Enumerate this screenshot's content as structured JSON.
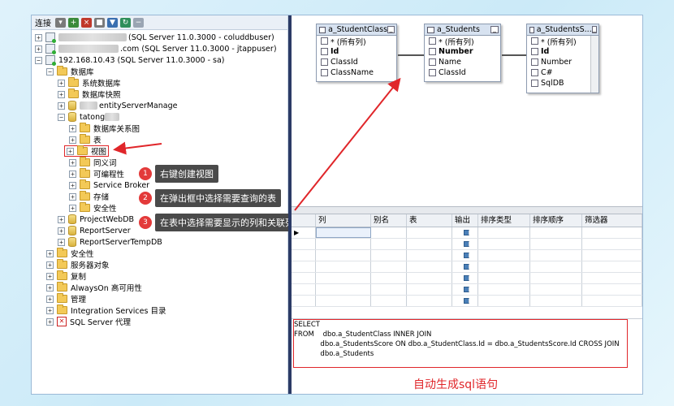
{
  "toolbar": {
    "connect_label": "连接"
  },
  "tree": {
    "server1": {
      "text_suffix": "(SQL Server 11.0.3000 - coluddbuser)"
    },
    "server2": {
      "text_suffix": ".com (SQL Server 11.0.3000 - jtappuser)"
    },
    "server3": {
      "label": "192.168.10.43 (SQL Server 11.0.3000 - sa)"
    },
    "databases": "数据库",
    "system_db": "系统数据库",
    "snapshots": "数据库快照",
    "db_identity_suffix": "entityServerManage",
    "db_current_prefix": "tatong",
    "db_diagram": "数据库关系图",
    "tables": "表",
    "views": "视图",
    "synonyms": "同义词",
    "programmability": "可编程性",
    "service_broker": "Service Broker",
    "storage": "存储",
    "security_inner": "安全性",
    "db_projectweb": "ProjectWebDB",
    "db_reportserver": "ReportServer",
    "db_reporttemp": "ReportServerTempDB",
    "security": "安全性",
    "server_objects": "服务器对象",
    "replication": "复制",
    "alwayson": "AlwaysOn 高可用性",
    "management": "管理",
    "integration": "Integration Services 目录",
    "agent": "SQL Server 代理"
  },
  "callouts": [
    {
      "num": "1",
      "text": "右键创建视图"
    },
    {
      "num": "2",
      "text": "在弹出框中选择需要查询的表"
    },
    {
      "num": "3",
      "text": "在表中选择需要显示的列和关联列"
    }
  ],
  "tables": [
    {
      "title": "a_StudentClass",
      "rows": [
        "* (所有列)",
        "Id",
        "ClassId",
        "ClassName"
      ],
      "bold": [
        "Id"
      ]
    },
    {
      "title": "a_Students",
      "rows": [
        "* (所有列)",
        "Number",
        "Name",
        "ClassId"
      ],
      "bold": [
        "Number"
      ]
    },
    {
      "title": "a_StudentsS...",
      "rows": [
        "* (所有列)",
        "Id",
        "Number",
        "C#",
        "SqlDB"
      ],
      "bold": [
        "Id"
      ]
    }
  ],
  "grid": {
    "headers": [
      "列",
      "别名",
      "表",
      "输出",
      "排序类型",
      "排序顺序",
      "筛选器"
    ]
  },
  "sql": {
    "line1": "SELECT",
    "line2": "FROM    dbo.a_StudentClass INNER JOIN",
    "line3": "            dbo.a_StudentsScore ON dbo.a_StudentClass.Id = dbo.a_StudentsScore.Id CROSS JOIN",
    "line4": "            dbo.a_Students"
  },
  "caption": "自动生成sql语句"
}
